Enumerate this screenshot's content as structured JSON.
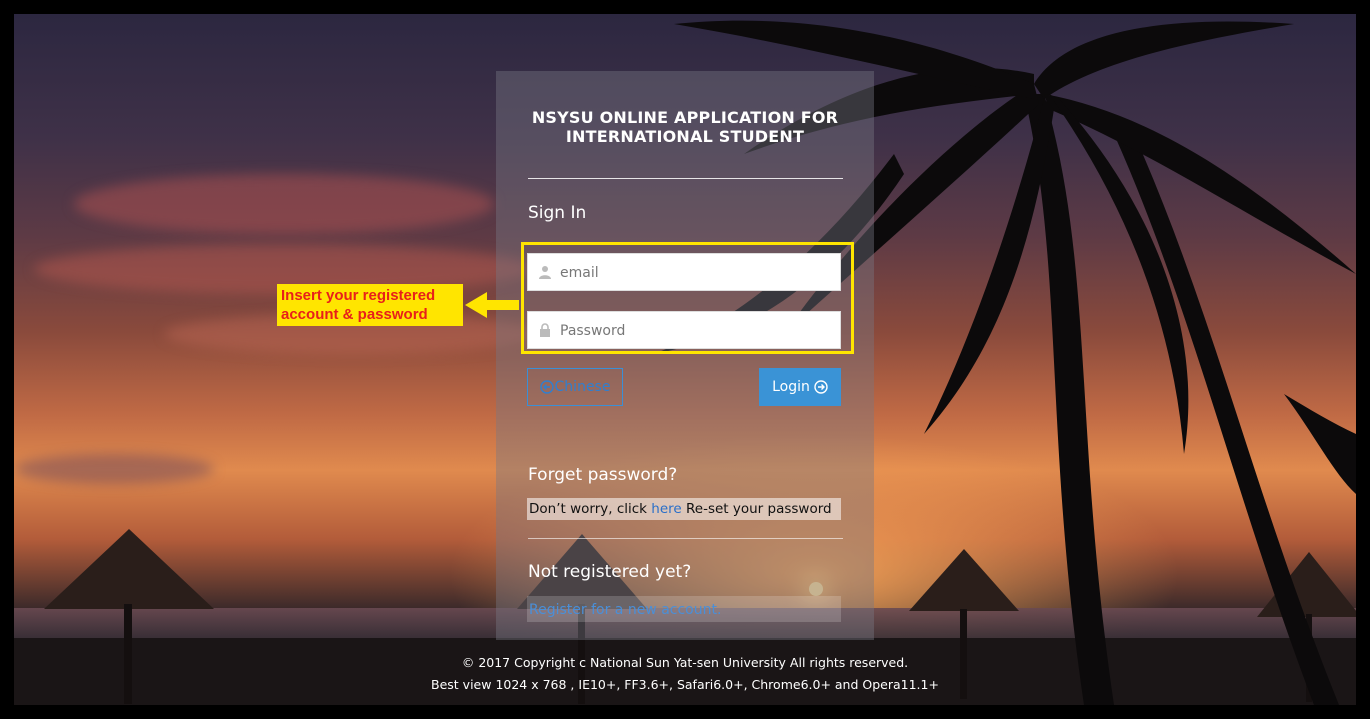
{
  "app": {
    "title_line1": "NSYSU ONLINE APPLICATION FOR",
    "title_line2": "INTERNATIONAL STUDENT"
  },
  "signin": {
    "heading": "Sign In",
    "email_placeholder": "email",
    "password_placeholder": "Password",
    "chinese_label": "Chinese",
    "login_label": "Login"
  },
  "annotation": {
    "line1": "Insert your registered",
    "line2": "account & password"
  },
  "forget": {
    "heading": "Forget password?",
    "prefix": "Don’t worry, click ",
    "link": "here",
    "suffix": " Re-set your password"
  },
  "register": {
    "heading": "Not registered yet?",
    "link": "Register for a new account."
  },
  "footer": {
    "copyright": "© 2017 Copyright c National Sun Yat-sen University All rights reserved.",
    "browsers": "Best view 1024 x 768 , IE10+, FF3.6+, Safari6.0+, Chrome6.0+ and Opera11.1+"
  },
  "colors": {
    "accent": "#3a93d6",
    "highlight": "#ffe500",
    "callout_text": "#e8201a"
  },
  "icons": {
    "email": "user-icon",
    "password": "lock-icon",
    "chinese": "circle-arrow-left-icon",
    "login": "circle-arrow-right-icon"
  }
}
